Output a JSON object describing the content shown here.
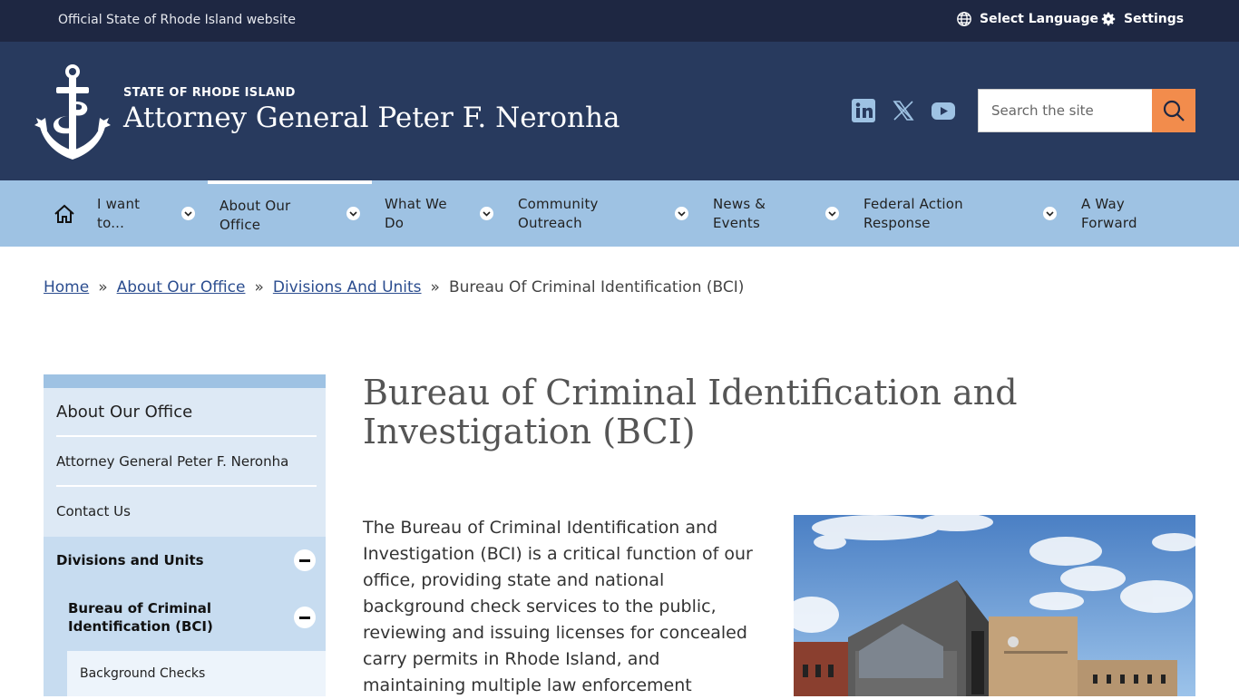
{
  "topbar": {
    "official_text": "Official State of Rhode Island website",
    "language_label": "Select Language",
    "settings_label": "Settings",
    "language_icon": "globe-icon",
    "settings_icon": "gear-icon"
  },
  "header": {
    "org": "STATE OF RHODE ISLAND",
    "title": "Attorney General Peter F. Neronha",
    "logo_icon": "anchor-icon",
    "social": [
      "linkedin-icon",
      "x-icon",
      "youtube-icon"
    ],
    "search_placeholder": "Search the site",
    "search_icon": "search-icon"
  },
  "nav": {
    "home_icon": "home-icon",
    "items": [
      {
        "line1": "I want",
        "line2": "to..."
      },
      {
        "line1": "About Our",
        "line2": "Office"
      },
      {
        "line1": "What We",
        "line2": "Do"
      },
      {
        "line1": "Community",
        "line2": "Outreach"
      },
      {
        "line1": "News &",
        "line2": "Events"
      },
      {
        "line1": "Federal Action",
        "line2": "Response"
      },
      {
        "line1": "A Way",
        "line2": "Forward"
      }
    ],
    "active_index": 1
  },
  "breadcrumb": {
    "items": [
      "Home",
      "About Our Office",
      "Divisions And Units"
    ],
    "current": "Bureau Of Criminal Identification (BCI)",
    "separator": "»"
  },
  "sidebar": {
    "heading": "About Our Office",
    "items": [
      "Attorney General Peter F. Neronha",
      "Contact Us",
      "Divisions and Units"
    ],
    "sub_item_line1": "Bureau of Criminal",
    "sub_item_line2": "Identification (BCI)",
    "sub_sub_item": "Background Checks"
  },
  "content": {
    "title_line1": "Bureau of Criminal Identification and",
    "title_line2": "Investigation (BCI)",
    "intro": "The Bureau of Criminal Identification and Investigation (BCI) is a critical function of our office, providing state and national background check services to the public, reviewing and issuing licenses for concealed carry permits in Rhode Island, and maintaining multiple law enforcement"
  },
  "colors": {
    "topbar": "#1e2742",
    "header": "#283a5e",
    "nav": "#9ec2e3",
    "search_button": "#f28c4c",
    "sidebar": "#dde9f5"
  }
}
